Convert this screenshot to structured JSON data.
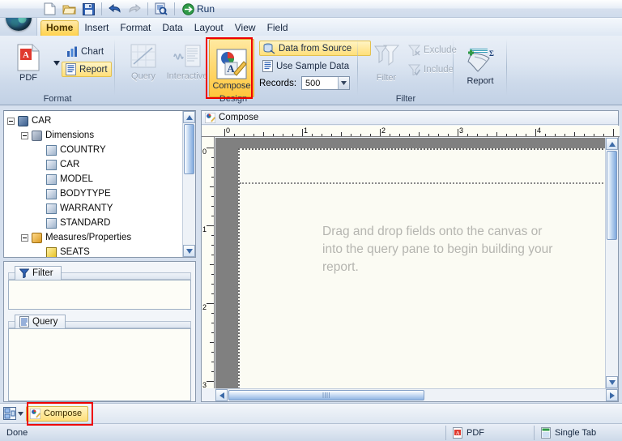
{
  "app": {
    "logo": "globe-icon"
  },
  "toolbar": {
    "buttons": [
      {
        "name": "new",
        "icon": "new-document-icon"
      },
      {
        "name": "open",
        "icon": "open-folder-icon"
      },
      {
        "name": "save",
        "icon": "save-disk-icon"
      },
      {
        "name": "undo",
        "icon": "undo-arrow-icon"
      },
      {
        "name": "redo",
        "icon": "redo-arrow-icon"
      },
      {
        "name": "preview",
        "icon": "preview-magnifier-icon"
      }
    ],
    "run_label": "Run",
    "help_label": "?"
  },
  "menubar": {
    "items": [
      {
        "label": "Home",
        "active": true
      },
      {
        "label": "Insert",
        "active": false
      },
      {
        "label": "Format",
        "active": false
      },
      {
        "label": "Data",
        "active": false
      },
      {
        "label": "Layout",
        "active": false
      },
      {
        "label": "View",
        "active": false
      },
      {
        "label": "Field",
        "active": false
      }
    ]
  },
  "ribbon": {
    "groups": [
      {
        "name": "format",
        "label": "Format",
        "pdf_label": "PDF",
        "chart_label": "Chart",
        "report_label": "Report"
      },
      {
        "name": "design",
        "label": "Design",
        "query_label": "Query",
        "interactive_label": "Interactive",
        "compose_label": "Compose",
        "data_from_source_label": "Data from Source",
        "use_sample_data_label": "Use Sample Data",
        "records_label": "Records:",
        "records_value": "500"
      },
      {
        "name": "filter",
        "label": "Filter",
        "filter_label": "Filter",
        "exclude_label": "Exclude",
        "include_label": "Include"
      },
      {
        "name": "report",
        "label": "",
        "report_label": "Report"
      }
    ]
  },
  "sidebar": {
    "tree": [
      {
        "label": "CAR",
        "level": 0,
        "icon": "cube-icon",
        "expander": "minus"
      },
      {
        "label": "Dimensions",
        "level": 1,
        "icon": "dimensions-icon",
        "expander": "minus"
      },
      {
        "label": "COUNTRY",
        "level": 2,
        "icon": "field-icon",
        "expander": "none"
      },
      {
        "label": "CAR",
        "level": 2,
        "icon": "field-icon",
        "expander": "none"
      },
      {
        "label": "MODEL",
        "level": 2,
        "icon": "field-icon",
        "expander": "none"
      },
      {
        "label": "BODYTYPE",
        "level": 2,
        "icon": "field-icon",
        "expander": "none"
      },
      {
        "label": "WARRANTY",
        "level": 2,
        "icon": "field-icon",
        "expander": "none"
      },
      {
        "label": "STANDARD",
        "level": 2,
        "icon": "field-icon",
        "expander": "none"
      },
      {
        "label": "Measures/Properties",
        "level": 1,
        "icon": "measures-icon",
        "expander": "minus"
      },
      {
        "label": "SEATS",
        "level": 2,
        "icon": "measure-field-icon",
        "expander": "none"
      }
    ],
    "filter_panel": {
      "label": "Filter",
      "icon": "funnel-icon"
    },
    "query_panel": {
      "label": "Query",
      "icon": "query-document-icon"
    }
  },
  "compose": {
    "title": "Compose",
    "icon": "compose-icon",
    "drop_hint": "Drag and drop fields onto the canvas or into the query pane to begin building your report.",
    "ruler_h_labels": [
      "0",
      "1",
      "2",
      "3",
      "4"
    ],
    "ruler_v_labels": [
      "0",
      "1",
      "2",
      "3"
    ]
  },
  "tabstrip": {
    "compose_tab": "Compose",
    "switch_icon": "layout-switch-icon"
  },
  "statusbar": {
    "message": "Done",
    "output_format": "PDF",
    "tab_mode": "Single Tab"
  },
  "annotations": {
    "highlight_color": "#ee0000",
    "boxes": [
      "compose-ribbon-button",
      "compose-bottom-tab"
    ]
  }
}
